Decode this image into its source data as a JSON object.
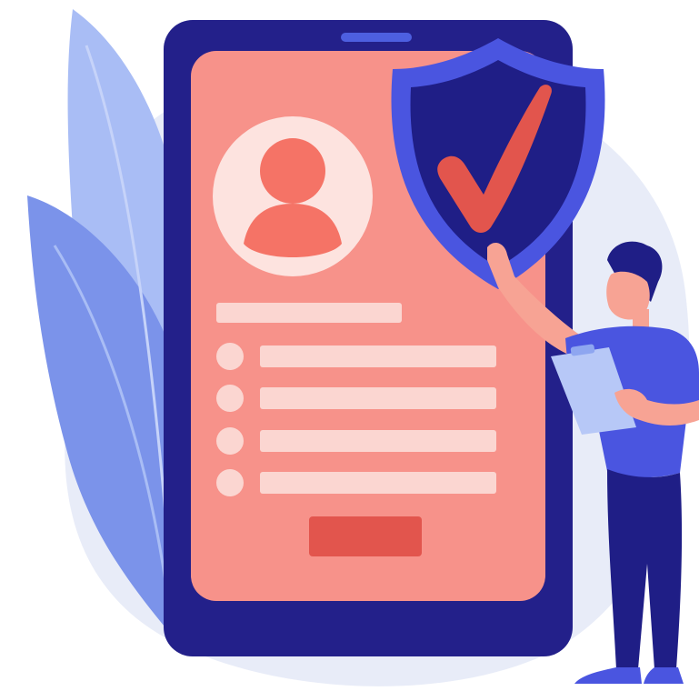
{
  "illustration": {
    "subject": "",
    "colors": {
      "background_blob": "#e8ecf8",
      "leaf_light": "#a9bdf5",
      "leaf_mid": "#8ea6f0",
      "leaf_dark": "#7b93ea",
      "phone_frame": "#23208a",
      "phone_speaker": "#4d5fe0",
      "screen": "#f7928a",
      "avatar_circle": "#fde3df",
      "avatar_figure": "#f57366",
      "form_line": "#fbd6d1",
      "form_bullet": "#fbd6d1",
      "submit_button": "#e2554d",
      "shield_outer": "#4a55e0",
      "shield_inner": "#1f1e86",
      "checkmark": "#e2554d",
      "person_shirt": "#4a55e0",
      "person_pants": "#1f1e86",
      "person_hair": "#1f1e86",
      "person_skin": "#f7a394",
      "clipboard": "#b7c8f7"
    },
    "form": {
      "field_count": 4
    },
    "icons": [
      "user-avatar-icon",
      "shield-check-icon",
      "clipboard-icon"
    ]
  }
}
